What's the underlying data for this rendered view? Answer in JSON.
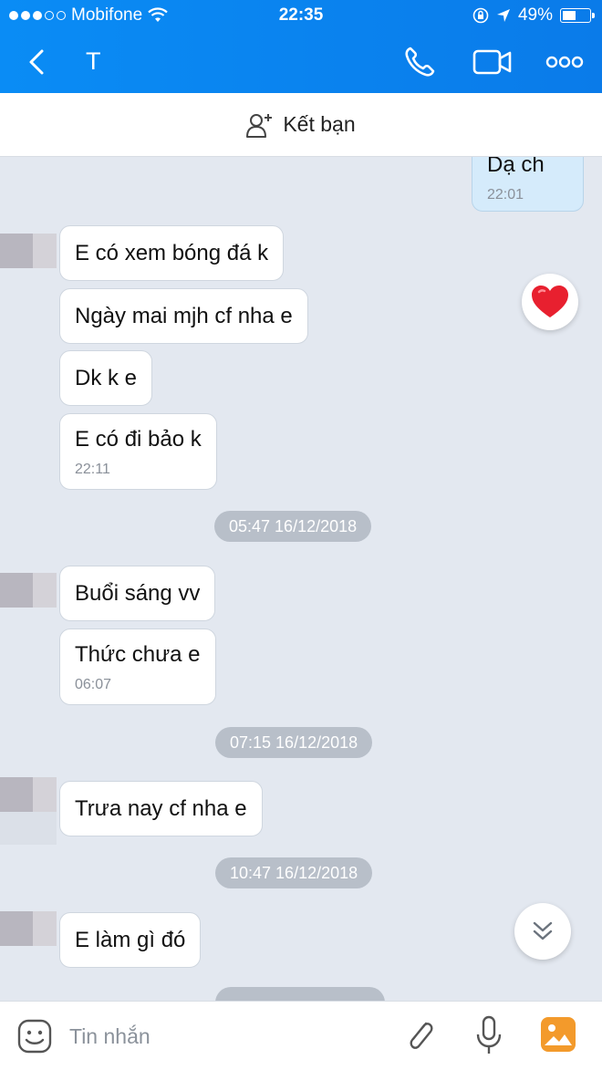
{
  "status_bar": {
    "carrier": "Mobifone",
    "time": "22:35",
    "battery": "49%"
  },
  "header": {
    "title": "T",
    "icons": [
      "back-icon",
      "phone-icon",
      "video-icon",
      "more-icon"
    ]
  },
  "add_friend": {
    "label": "Kết bạn",
    "icon": "add-friend-icon"
  },
  "messages": {
    "sent_partial": {
      "text": "Dạ ch",
      "time": "22:01"
    },
    "m1": "E có xem bóng đá k",
    "m2": "Ngày mai mjh cf nha e",
    "m3": "Dk k e",
    "m4": {
      "text": "E có đi bảo k",
      "time": "22:11"
    },
    "d1": "05:47 16/12/2018",
    "m5": "Buổi sáng vv",
    "m6": {
      "text": "Thức chưa e",
      "time": "06:07"
    },
    "d2": "07:15 16/12/2018",
    "m7": "Trưa nay cf nha e",
    "d3": "10:47 16/12/2018",
    "m8": "E làm gì đó"
  },
  "input_bar": {
    "placeholder": "Tin nhắn",
    "icons": [
      "emoji-icon",
      "attach-icon",
      "mic-icon",
      "gallery-icon"
    ]
  },
  "colors": {
    "header": "#0a8cf5",
    "chat_bg": "#e3e8f0",
    "sent_bubble": "#d5ebfb",
    "divider": "#b8bfc9",
    "heart": "#e8202f"
  }
}
